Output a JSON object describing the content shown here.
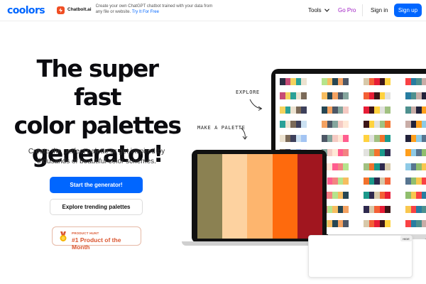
{
  "header": {
    "logo": "coolors",
    "ad": {
      "brand": "Chatbolt.ai",
      "text": "Create your own ChatGPT chatbot trained with your data from any file or website.",
      "cta": "Try It For Free"
    },
    "nav": {
      "tools": "Tools",
      "gopro": "Go Pro",
      "signin": "Sign in",
      "signup": "Sign up"
    }
  },
  "hero": {
    "title_lines": [
      "The super fast",
      "color palettes",
      "generator!"
    ],
    "subtitle_lines": [
      "Create the perfect palette or get inspired by",
      "thousands of beautiful color schemes."
    ],
    "primary_button": "Start the generator!",
    "secondary_button": "Explore trending palettes",
    "badge": {
      "top": "PRODUCT HUNT",
      "main": "#1 Product of the Month"
    }
  },
  "illustration": {
    "explore_label": "EXPLORE",
    "make_label": "MAKE A PALETTE",
    "hide_label": "HIDE",
    "laptop_palette": [
      "#8b8152",
      "#fdd2a0",
      "#fdb56e",
      "#fe6a0d",
      "#a1161f"
    ],
    "explore_palettes": [
      [
        "#2b2d42",
        "#c74b76",
        "#f4d35e",
        "#2aa198",
        "#ece2d0",
        "#7b6a58",
        "#3d405b",
        "#cbe1f2",
        "#a3c4f3",
        "#f6e6ff"
      ],
      [
        "#f28482",
        "#b5e48c",
        "#f6bd60",
        "#264653",
        "#f4a261",
        "#4d5766",
        "#84a59d",
        "#f5cac3",
        "#ffe8d6",
        "#ff5d8f"
      ],
      [
        "#1b998b",
        "#2e294e",
        "#d7c9aa",
        "#f46036",
        "#e71d36",
        "#3c1518",
        "#ffd23f",
        "#e2e2df",
        "#a1c181",
        "#f3722c"
      ],
      [
        "#577590",
        "#90be6d",
        "#f9c74f",
        "#f94144",
        "#277da1",
        "#4d908e",
        "#c9ada7",
        "#22223b",
        "#ff9f1c",
        "#8ecae6"
      ]
    ],
    "colors": {
      "accent": "#0066ff",
      "gopro": "#a020c4",
      "producthunt": "#da552f"
    }
  }
}
